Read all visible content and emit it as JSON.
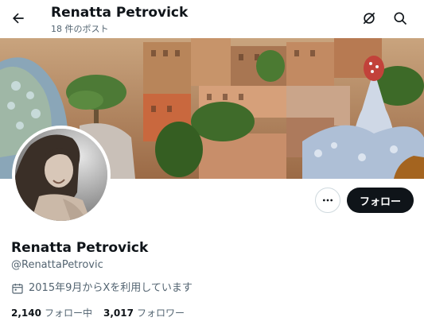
{
  "header": {
    "title": "Renatta Petrovick",
    "post_count": "18 件のポスト"
  },
  "profile": {
    "display_name": "Renatta Petrovick",
    "handle": "@RenattaPetrovic",
    "joined": "2015年9月からXを利用しています",
    "following_count": "2,140",
    "following_label": "フォロー中",
    "followers_count": "3,017",
    "followers_label": "フォロワー"
  },
  "actions": {
    "follow_label": "フォロー"
  },
  "icons": {
    "back": "arrow-left-icon",
    "grok": "grok-icon",
    "search": "search-icon",
    "more": "more-icon",
    "calendar": "calendar-icon"
  },
  "colors": {
    "text_primary": "#0f1419",
    "text_secondary": "#536471",
    "follow_button": "#0f1419",
    "border": "#cfd9de"
  }
}
